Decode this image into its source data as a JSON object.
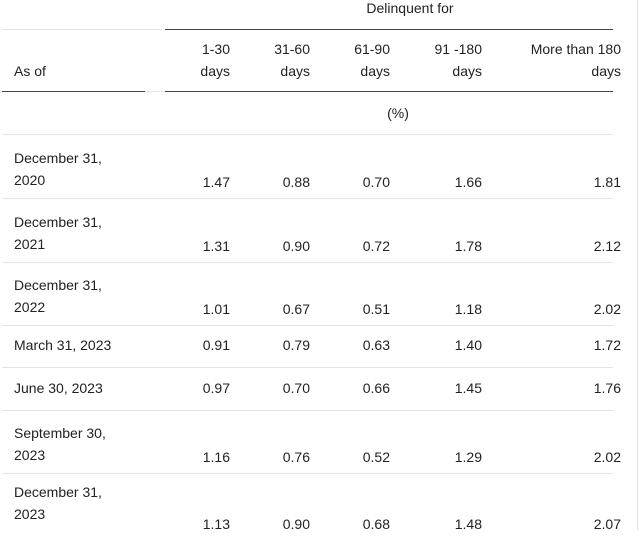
{
  "table": {
    "group_header": "Delinquent for",
    "columns": {
      "as_of": "As of",
      "c1": [
        "1-30",
        "days"
      ],
      "c2": [
        "31-60",
        "days"
      ],
      "c3": [
        "61-90",
        "days"
      ],
      "c4": [
        "91 -180",
        "days"
      ],
      "c5": [
        "More than 180",
        "days"
      ]
    },
    "unit": "(%)",
    "rows": [
      {
        "date": [
          "December 31,",
          "2020"
        ],
        "values": [
          "1.47",
          "0.88",
          "0.70",
          "1.66",
          "1.81"
        ]
      },
      {
        "date": [
          "December 31,",
          "2021"
        ],
        "values": [
          "1.31",
          "0.90",
          "0.72",
          "1.78",
          "2.12"
        ]
      },
      {
        "date": [
          "December 31,",
          "2022"
        ],
        "values": [
          "1.01",
          "0.67",
          "0.51",
          "1.18",
          "2.02"
        ]
      },
      {
        "date": [
          "March 31, 2023"
        ],
        "values": [
          "0.91",
          "0.79",
          "0.63",
          "1.40",
          "1.72"
        ]
      },
      {
        "date": [
          "June 30, 2023"
        ],
        "values": [
          "0.97",
          "0.70",
          "0.66",
          "1.45",
          "1.76"
        ]
      },
      {
        "date": [
          "September 30,",
          "2023"
        ],
        "values": [
          "1.16",
          "0.76",
          "0.52",
          "1.29",
          "2.02"
        ]
      },
      {
        "date": [
          "December 31,",
          "2023"
        ],
        "values": [
          "1.13",
          "0.90",
          "0.68",
          "1.48",
          "2.07"
        ]
      }
    ]
  }
}
